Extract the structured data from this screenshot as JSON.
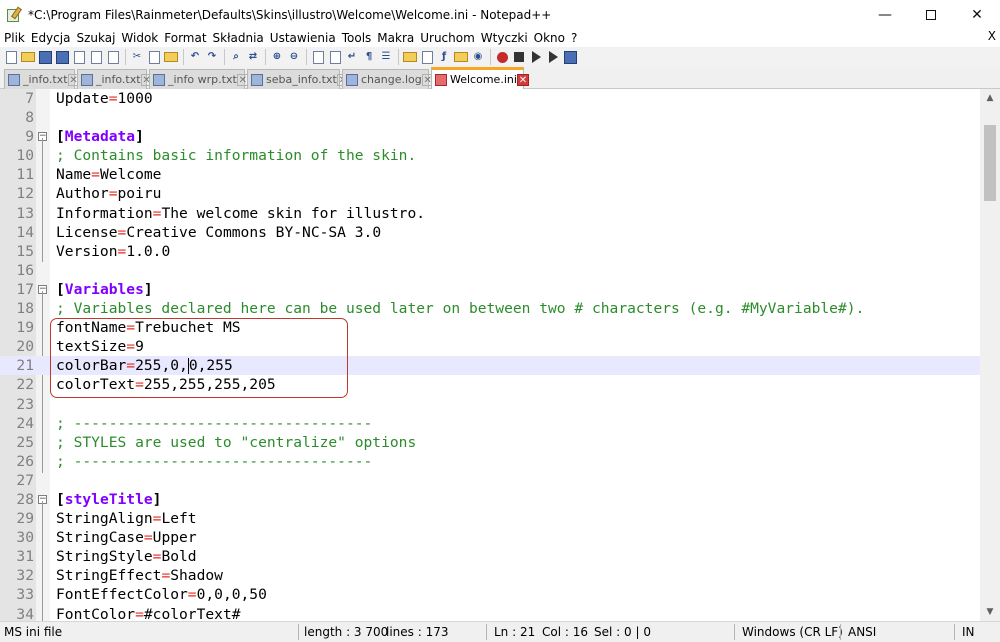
{
  "window": {
    "title": "*C:\\Program Files\\Rainmeter\\Defaults\\Skins\\illustro\\Welcome\\Welcome.ini - Notepad++",
    "minimize_glyph": "—",
    "close_glyph": "✕"
  },
  "menu": {
    "items": [
      "Plik",
      "Edycja",
      "Szukaj",
      "Widok",
      "Format",
      "Składnia",
      "Ustawienia",
      "Tools",
      "Makra",
      "Uruchom",
      "Wtyczki",
      "Okno",
      "?"
    ],
    "close_label": "X"
  },
  "tabs": [
    {
      "label": "_info.txt",
      "active": false
    },
    {
      "label": "_info.txt",
      "active": false
    },
    {
      "label": "_info wrp.txt",
      "active": false
    },
    {
      "label": "seba_info.txt",
      "active": false
    },
    {
      "label": "change.log",
      "active": false
    },
    {
      "label": "Welcome.ini",
      "active": true
    }
  ],
  "editor": {
    "lines": [
      {
        "n": "7",
        "kind": "kv",
        "key": "Update",
        "value": "1000"
      },
      {
        "n": "8",
        "kind": "blank"
      },
      {
        "n": "9",
        "kind": "section",
        "name": "Metadata"
      },
      {
        "n": "10",
        "kind": "comment",
        "text": "; Contains basic information of the skin."
      },
      {
        "n": "11",
        "kind": "kv",
        "key": "Name",
        "value": "Welcome"
      },
      {
        "n": "12",
        "kind": "kv",
        "key": "Author",
        "value": "poiru"
      },
      {
        "n": "13",
        "kind": "kv",
        "key": "Information",
        "value": "The welcome skin for illustro."
      },
      {
        "n": "14",
        "kind": "kv",
        "key": "License",
        "value": "Creative Commons BY-NC-SA 3.0"
      },
      {
        "n": "15",
        "kind": "kv",
        "key": "Version",
        "value": "1.0.0"
      },
      {
        "n": "16",
        "kind": "blank"
      },
      {
        "n": "17",
        "kind": "section",
        "name": "Variables"
      },
      {
        "n": "18",
        "kind": "comment",
        "text": "; Variables declared here can be used later on between two # characters (e.g. #MyVariable#)."
      },
      {
        "n": "19",
        "kind": "kv",
        "key": "fontName",
        "value": "Trebuchet MS"
      },
      {
        "n": "20",
        "kind": "kv",
        "key": "textSize",
        "value": "9"
      },
      {
        "n": "21",
        "kind": "kv-caret",
        "key": "colorBar",
        "value_before": "255,0,",
        "value_after": "0,255"
      },
      {
        "n": "22",
        "kind": "kv",
        "key": "colorText",
        "value": "255,255,255,205"
      },
      {
        "n": "23",
        "kind": "blank"
      },
      {
        "n": "24",
        "kind": "comment",
        "text": "; ----------------------------------"
      },
      {
        "n": "25",
        "kind": "comment",
        "text": "; STYLES are used to \"centralize\" options"
      },
      {
        "n": "26",
        "kind": "comment",
        "text": "; ----------------------------------"
      },
      {
        "n": "27",
        "kind": "blank"
      },
      {
        "n": "28",
        "kind": "section",
        "name": "styleTitle"
      },
      {
        "n": "29",
        "kind": "kv",
        "key": "StringAlign",
        "value": "Left"
      },
      {
        "n": "30",
        "kind": "kv",
        "key": "StringCase",
        "value": "Upper"
      },
      {
        "n": "31",
        "kind": "kv",
        "key": "StringStyle",
        "value": "Bold"
      },
      {
        "n": "32",
        "kind": "kv",
        "key": "StringEffect",
        "value": "Shadow"
      },
      {
        "n": "33",
        "kind": "kv",
        "key": "FontEffectColor",
        "value": "0,0,0,50"
      },
      {
        "n": "34",
        "kind": "kv",
        "key": "FontColor",
        "value": "#colorText#"
      }
    ],
    "current_line": "21"
  },
  "statusbar": {
    "file_type": "MS ini file",
    "length": "length : 3 700",
    "lines": "lines : 173",
    "ln": "Ln : 21",
    "col": "Col : 16",
    "sel": "Sel : 0 | 0",
    "eol": "Windows (CR LF)",
    "encoding": "ANSI",
    "mode": "IN"
  },
  "colors": {
    "section": "#8000ff",
    "comment": "#2c8c2c",
    "operator": "#e22b1f",
    "current_line": "#e8e8ff",
    "highlight_box": "#c0392b",
    "active_tab_accent": "#f5a623"
  }
}
